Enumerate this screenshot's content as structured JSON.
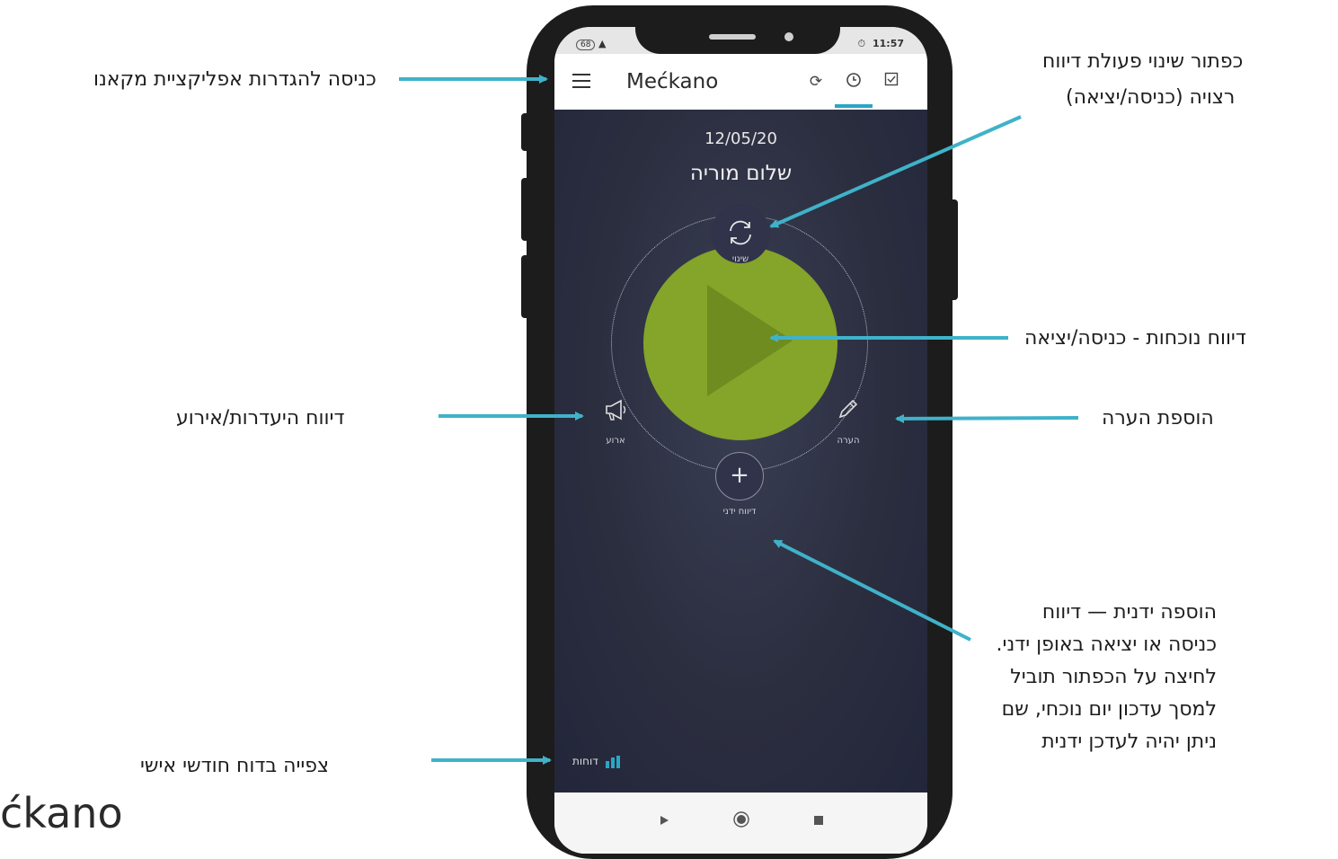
{
  "annotations": {
    "settings": "כניסה להגדרות אפליקציית מקאנו",
    "change_action_line1": "כפתור שינוי פעולת דיווח",
    "change_action_line2": "רצויה (כניסה/יציאה)",
    "presence_report": "דיווח נוכחות - כניסה/יציאה",
    "absence_event": "דיווח היעדרות/אירוע",
    "add_note": "הוספת הערה",
    "manual_add": "הוספה ידנית — דיווח כניסה או יציאה באופן ידני. לחיצה על הכפתור תוביל למסך עדכון יום נוכחי, שם ניתן יהיה לעדכן ידנית",
    "monthly_report": "צפייה בדוח חודשי אישי"
  },
  "footer_brand": "ćkano",
  "phone": {
    "status": {
      "left": "68",
      "time": "11:57"
    },
    "app_title": "Mećkano",
    "date": "12/05/20",
    "greeting": "שלום מוריה",
    "switch_label": "שינוי",
    "event_label": "ארוע",
    "note_label": "הערה",
    "manual_label": "דיווח ידני",
    "reports_label": "דוחות"
  },
  "icons": {
    "menu": "hamburger-icon",
    "refresh": "refresh-icon",
    "clock": "clock-icon",
    "checklist": "checkbox-icon",
    "switch": "sync-icon",
    "event": "megaphone-icon",
    "note": "pencil-icon",
    "plus": "plus-icon",
    "reports": "bar-chart-icon"
  },
  "colors": {
    "accent": "#2aa6c4",
    "play_green": "#84a42a",
    "background_dark": "#2b2e3f"
  }
}
